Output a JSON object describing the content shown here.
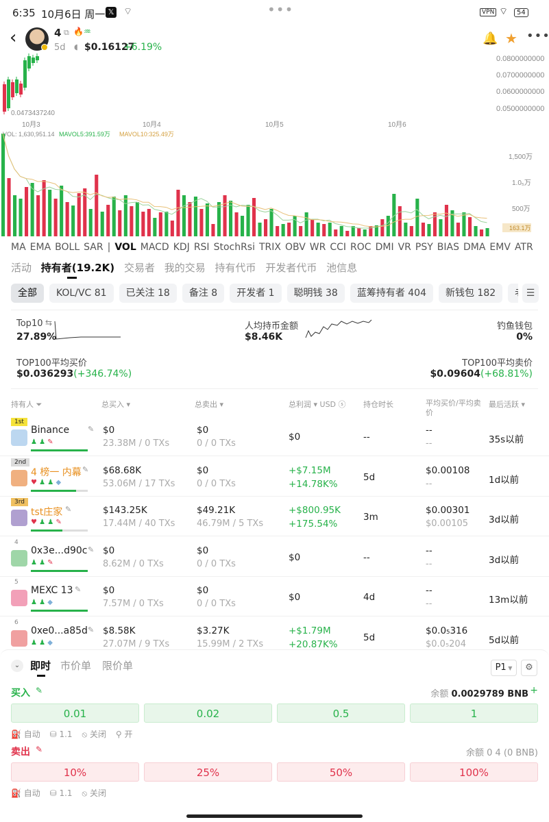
{
  "status": {
    "time": "6:35",
    "date": "10月6日 周一",
    "vpn": "VPN",
    "battery": "54"
  },
  "header": {
    "token": "4",
    "age": "5d",
    "price": "$0.16127",
    "change": "+6.19%"
  },
  "chart": {
    "y_ticks": [
      "0.0800000000",
      "0.0700000000",
      "0.0600000000",
      "0.0500000000"
    ],
    "low_label": "0.0473437240",
    "x_ticks": [
      "10月3",
      "10月4",
      "10月5",
      "10月6"
    ],
    "vol_line": {
      "vol": "VOL: 1,630,951.14",
      "mavol5": "MAVOL5:391.59万",
      "mavol10": "MAVOL10:325.49万"
    },
    "vol_ticks": [
      "1,500万",
      "1.0₅万",
      "500万"
    ],
    "last_vol": "163.1万",
    "colors": {
      "up": "#27b24a",
      "down": "#e0324b",
      "ma5": "#9bd39b",
      "ma10": "#e8c078"
    },
    "indicators": [
      "MA",
      "EMA",
      "BOLL",
      "SAR",
      "|",
      "VOL",
      "MACD",
      "KDJ",
      "RSI",
      "StochRsi",
      "TRIX",
      "OBV",
      "WR",
      "CCI",
      "ROC",
      "DMI",
      "VR",
      "PSY",
      "BIAS",
      "DMA",
      "EMV",
      "ATR"
    ]
  },
  "tabs": [
    "活动",
    "持有者(19.2K)",
    "交易者",
    "我的交易",
    "持有代币",
    "开发者代币",
    "池信息"
  ],
  "chips": [
    "全部",
    "KOL/VC 81",
    "已关注 18",
    "备注 8",
    "开发者 1",
    "聪明钱 38",
    "蓝筹持有者 404",
    "新钱包 182",
    "老鼠仓"
  ],
  "summary": {
    "top10_label": "Top10",
    "top10_value": "27.89%",
    "avg_hold_label": "人均持币金额",
    "avg_hold_value": "$8.46K",
    "fish_label": "钓鱼钱包",
    "fish_value": "0%",
    "buy_label": "TOP100平均买价",
    "buy_value": "$0.036293",
    "buy_change": "(+346.74%)",
    "sell_label": "TOP100平均卖价",
    "sell_value": "$0.09604",
    "sell_change": "(+68.81%)"
  },
  "columns": [
    "持有人",
    "总买入",
    "总卖出",
    "总利润",
    "USD",
    "持仓时长",
    "平均买价/平均卖价",
    "最后活跃"
  ],
  "holders": [
    {
      "rank": "1st",
      "name": "Binance",
      "buy": "$0",
      "buy_sub": "23.38M / 0 TXs",
      "sell": "$0",
      "sell_sub": "0 / 0 TXs",
      "profit": "$0",
      "profit_sub": "",
      "dur": "--",
      "avg": "--",
      "avg_sub": "--",
      "last": "35s以前",
      "rc": "#f5e23a",
      "av": "#bcd7f0",
      "share": 100
    },
    {
      "rank": "2nd",
      "name": "4 榜一 内幕",
      "buy": "$68.68K",
      "buy_sub": "53.06M / 17 TXs",
      "sell": "$0",
      "sell_sub": "0 / 0 TXs",
      "profit": "+$7.15M",
      "profit_sub": "+14.78K%",
      "dur": "5d",
      "avg": "$0.00108",
      "avg_sub": "--",
      "last": "1d以前",
      "rc": "#dcdcdc",
      "av": "#f0b080",
      "share": 80
    },
    {
      "rank": "3rd",
      "name": "tst庄家",
      "buy": "$143.25K",
      "buy_sub": "17.44M / 40 TXs",
      "sell": "$49.21K",
      "sell_sub": "46.79M / 5 TXs",
      "profit": "+$800.95K",
      "profit_sub": "+175.54%",
      "dur": "3m",
      "avg": "$0.00301",
      "avg_sub": "$0.00105",
      "last": "3d以前",
      "rc": "#f0c060",
      "av": "#b0a0d0",
      "share": 55
    },
    {
      "rank": "4",
      "name": "0x3e...d90c",
      "buy": "$0",
      "buy_sub": "8.62M / 0 TXs",
      "sell": "$0",
      "sell_sub": "0 / 0 TXs",
      "profit": "$0",
      "profit_sub": "",
      "dur": "--",
      "avg": "--",
      "avg_sub": "--",
      "last": "3d以前",
      "rc": "",
      "av": "#9fd6a8",
      "share": 100
    },
    {
      "rank": "5",
      "name": "MEXC 13",
      "buy": "$0",
      "buy_sub": "7.57M / 0 TXs",
      "sell": "$0",
      "sell_sub": "0 / 0 TXs",
      "profit": "$0",
      "profit_sub": "",
      "dur": "4d",
      "avg": "--",
      "avg_sub": "--",
      "last": "13m以前",
      "rc": "",
      "av": "#f2a0b8",
      "share": 100
    },
    {
      "rank": "6",
      "name": "0xe0...a85d",
      "buy": "$8.58K",
      "buy_sub": "27.07M / 9 TXs",
      "sell": "$3.27K",
      "sell_sub": "15.99M / 2 TXs",
      "profit": "+$1.79M",
      "profit_sub": "+20.87K%",
      "dur": "5d",
      "avg": "$0.0₅316",
      "avg_sub": "$0.0₅204",
      "last": "5d以前",
      "rc": "",
      "av": "#f0a0a0",
      "share": 60
    }
  ],
  "order": {
    "tabs": [
      "即时",
      "市价单",
      "限价单"
    ],
    "p1": "P1",
    "buy_label": "买入",
    "balance_label": "余额",
    "balance_value": "0.0029789 BNB",
    "buy_amounts": [
      "0.01",
      "0.02",
      "0.5",
      "1"
    ],
    "opts1": [
      "自动",
      "1.1",
      "关闭",
      "开"
    ],
    "sell_label": "卖出",
    "sell_balance": "余额 0 4 (0 BNB)",
    "sell_amounts": [
      "10%",
      "25%",
      "50%",
      "100%"
    ],
    "opts2": [
      "自动",
      "1.1",
      "关闭"
    ]
  }
}
